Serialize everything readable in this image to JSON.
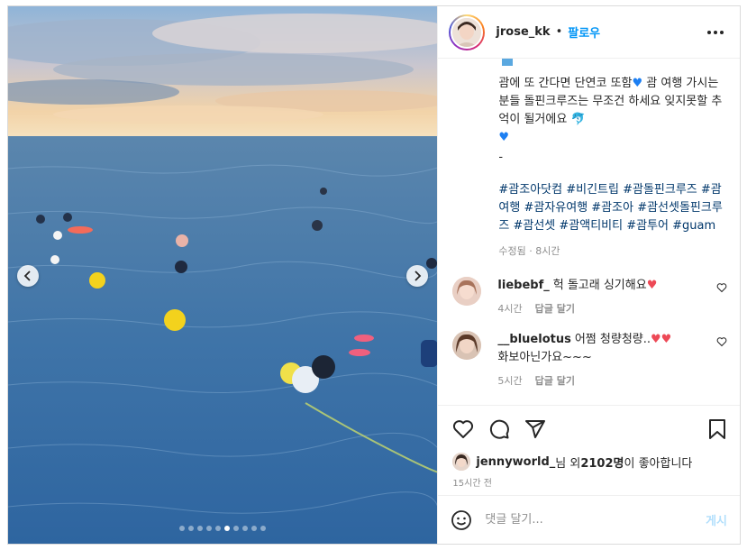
{
  "post": {
    "username": "jrose_kk",
    "separator": "•",
    "follow_label": "팔로우",
    "more_icon": "more-horizontal-icon"
  },
  "carousel": {
    "slide_count": 10,
    "active_index": 5,
    "prev_icon": "chevron-left-icon",
    "next_icon": "chevron-right-icon"
  },
  "caption": {
    "line1": "괌에 또 간다면 단연코 또함",
    "line1_tail": " 괌 여행 가시는 분들 돌핀크루즈는 무조건 하세요 잊지못할 추억이 될거에요 ",
    "dash": "-",
    "hashtags": "#괌조아닷컴 #비긴트립 #괌돌핀크루즈 #괌여행 #괌자유여행 #괌조아 #괌선셋돌핀크루즈 #괌선셋 #괌액티비티 #괌투어 #guam",
    "meta": "수정됨 · 8시간"
  },
  "comments": [
    {
      "user": "liebebf_",
      "text": "헉 돌고래 싱기해요",
      "time": "4시간",
      "reply": "답글 달기"
    },
    {
      "user": "__bluelotus",
      "text": "어쩜 청량청량..",
      "text2": "화보아닌가요~~~",
      "time": "5시간",
      "reply": "답글 달기"
    }
  ],
  "likes": {
    "user": "jennyworld_",
    "suffix": "님 외 ",
    "count": "2102명",
    "tail": "이 좋아합니다",
    "time": "15시간 전"
  },
  "comment_input": {
    "placeholder": "댓글 달기...",
    "post_label": "게시"
  },
  "colors": {
    "follow": "#0095f6",
    "hashtag": "#00376b",
    "heart_red": "#ed4956",
    "heart_blue": "#1d7ff2",
    "post_disabled": "#b2dffc"
  }
}
